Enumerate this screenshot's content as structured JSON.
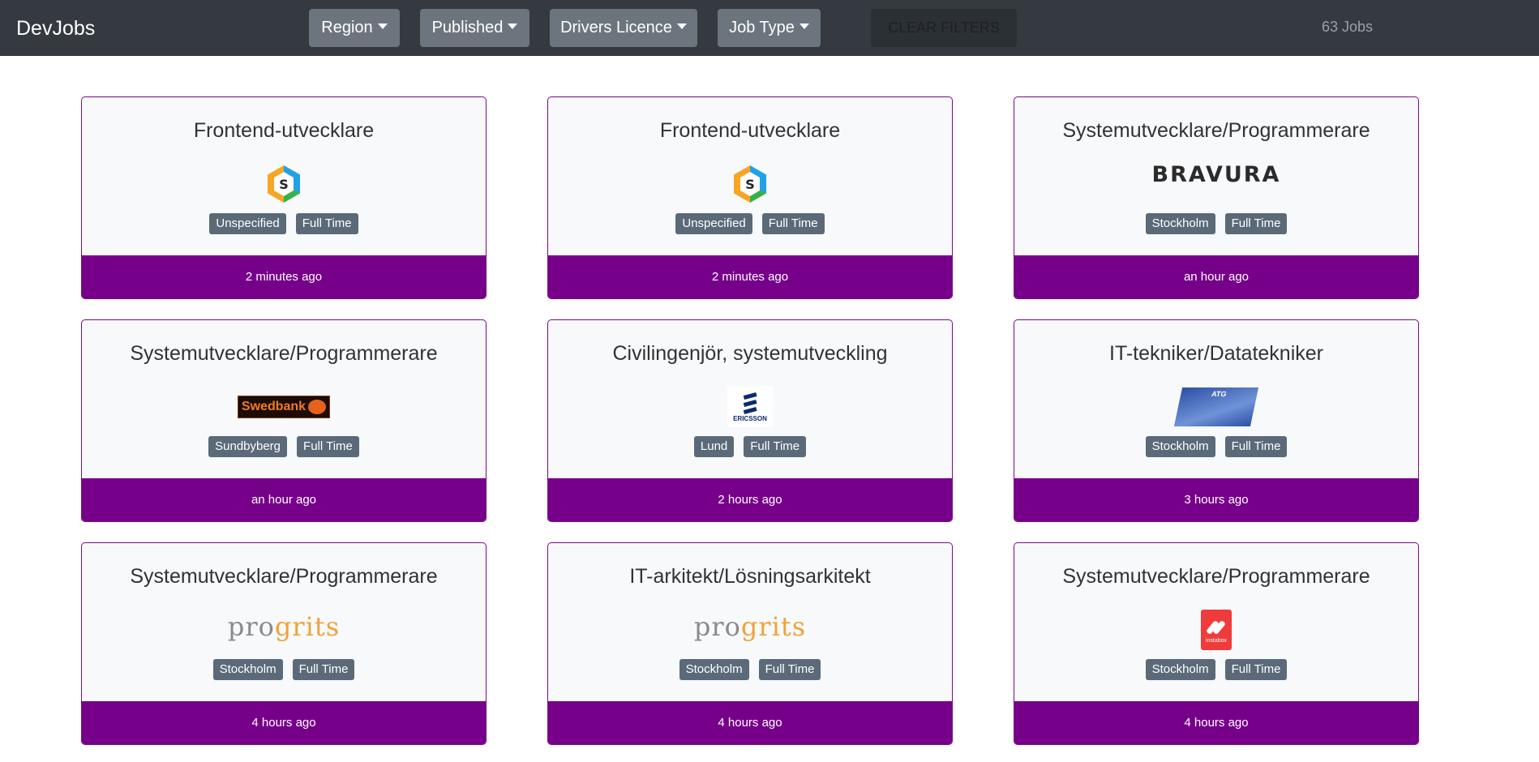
{
  "header": {
    "brand": "DevJobs",
    "filters": [
      {
        "label": "Region"
      },
      {
        "label": "Published"
      },
      {
        "label": "Drivers Licence"
      },
      {
        "label": "Job Type"
      }
    ],
    "clear_label": "CLEAR FILTERS",
    "job_count": "63 Jobs"
  },
  "jobs": [
    {
      "title": "Frontend-utvecklare",
      "logo": "hexagon-s-logo",
      "location": "Unspecified",
      "type": "Full Time",
      "published": "2 minutes ago"
    },
    {
      "title": "Frontend-utvecklare",
      "logo": "hexagon-s-logo",
      "location": "Unspecified",
      "type": "Full Time",
      "published": "2 minutes ago"
    },
    {
      "title": "Systemutvecklare/Programmerare",
      "logo": "bravura-logo",
      "logo_text": "BRAVURA",
      "location": "Stockholm",
      "type": "Full Time",
      "published": "an hour ago"
    },
    {
      "title": "Systemutvecklare/Programmerare",
      "logo": "swedbank-logo",
      "logo_text": "Swedbank",
      "location": "Sundbyberg",
      "type": "Full Time",
      "published": "an hour ago"
    },
    {
      "title": "Civilingenjör, systemutveckling",
      "logo": "ericsson-logo",
      "logo_text": "ERICSSON",
      "location": "Lund",
      "type": "Full Time",
      "published": "2 hours ago"
    },
    {
      "title": "IT-tekniker/Datatekniker",
      "logo": "atg-logo",
      "logo_text": "ATG",
      "location": "Stockholm",
      "type": "Full Time",
      "published": "3 hours ago"
    },
    {
      "title": "Systemutvecklare/Programmerare",
      "logo": "progrits-logo",
      "logo_text": "progrits",
      "location": "Stockholm",
      "type": "Full Time",
      "published": "4 hours ago"
    },
    {
      "title": "IT-arkitekt/Lösningsarkitekt",
      "logo": "progrits-logo",
      "logo_text": "progrits",
      "location": "Stockholm",
      "type": "Full Time",
      "published": "4 hours ago"
    },
    {
      "title": "Systemutvecklare/Programmerare",
      "logo": "instabox-logo",
      "logo_text": "instabox",
      "location": "Stockholm",
      "type": "Full Time",
      "published": "4 hours ago"
    }
  ]
}
